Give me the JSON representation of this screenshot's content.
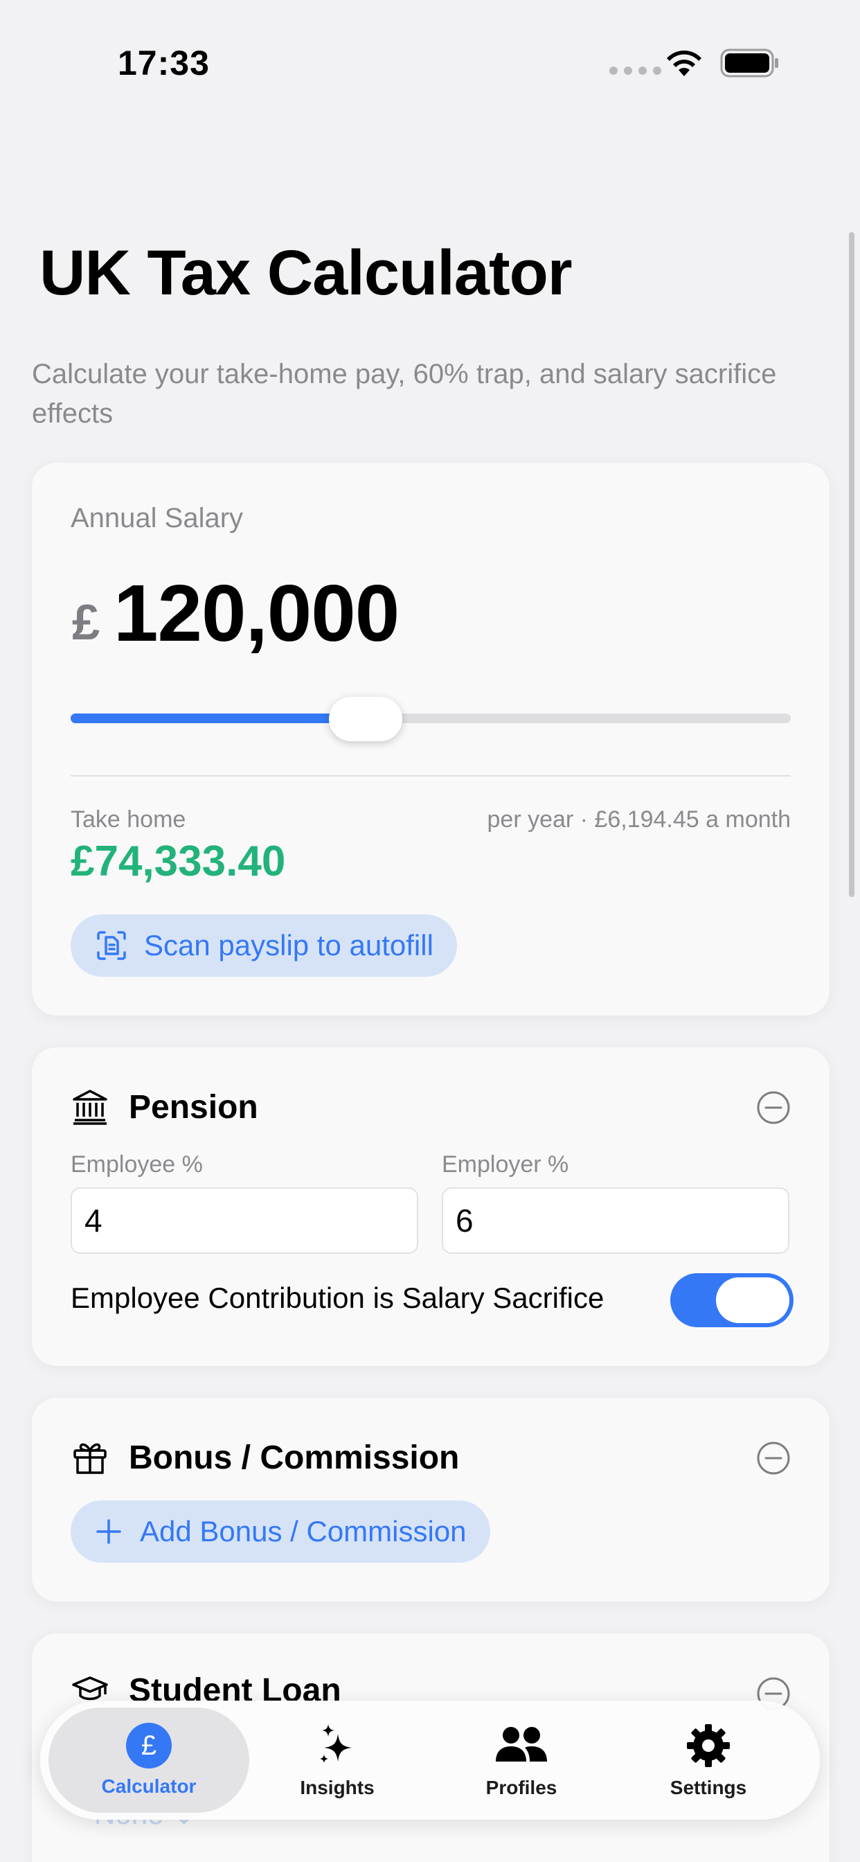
{
  "status_bar": {
    "time": "17:33"
  },
  "header": {
    "title": "UK Tax Calculator",
    "subtitle": "Calculate your take-home pay, 60% trap, and salary sacrifice effects"
  },
  "salary": {
    "label": "Annual Salary",
    "currency": "£",
    "value": "120,000",
    "slider_fraction": 0.41,
    "take_home_label": "Take home",
    "take_home_period": "per year · £6,194.45 a month",
    "take_home_value": "£74,333.40",
    "scan_button": "Scan payslip to autofill"
  },
  "pension": {
    "title": "Pension",
    "employee_label": "Employee %",
    "employee_value": "4",
    "employer_label": "Employer %",
    "employer_value": "6",
    "toggle_label": "Employee Contribution is Salary Sacrifice",
    "toggle_on": true
  },
  "bonus": {
    "title": "Bonus / Commission",
    "add_button": "Add Bonus / Commission"
  },
  "student_loan": {
    "title": "Student Loan",
    "selected": "None"
  },
  "tab_bar": {
    "tabs": [
      {
        "label": "Calculator",
        "icon": "pound-circle-icon",
        "active": true
      },
      {
        "label": "Insights",
        "icon": "sparkles-icon",
        "active": false
      },
      {
        "label": "Profiles",
        "icon": "people-icon",
        "active": false
      },
      {
        "label": "Settings",
        "icon": "gear-icon",
        "active": false
      }
    ]
  },
  "colors": {
    "accent": "#3478f6",
    "take_home": "#23b37a",
    "background": "#f2f2f4"
  }
}
